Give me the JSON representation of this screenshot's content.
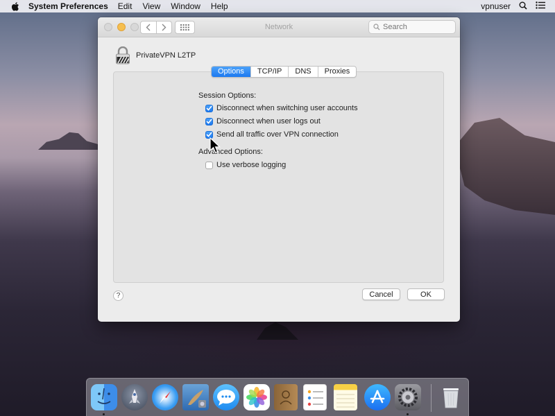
{
  "menubar": {
    "app_name": "System Preferences",
    "items": [
      "Edit",
      "View",
      "Window",
      "Help"
    ],
    "username": "vpnuser"
  },
  "window": {
    "title": "Network",
    "search_placeholder": "Search"
  },
  "vpn": {
    "name": "PrivateVPN L2TP"
  },
  "tabs": [
    {
      "label": "Options",
      "active": true
    },
    {
      "label": "TCP/IP",
      "active": false
    },
    {
      "label": "DNS",
      "active": false
    },
    {
      "label": "Proxies",
      "active": false
    }
  ],
  "session_options": {
    "label": "Session Options:",
    "items": [
      {
        "label": "Disconnect when switching user accounts",
        "checked": true
      },
      {
        "label": "Disconnect when user logs out",
        "checked": true
      },
      {
        "label": "Send all traffic over VPN connection",
        "checked": true
      }
    ]
  },
  "advanced_options": {
    "label": "Advanced Options:",
    "items": [
      {
        "label": "Use verbose logging",
        "checked": false
      }
    ]
  },
  "buttons": {
    "help": "?",
    "cancel": "Cancel",
    "ok": "OK"
  },
  "dock": {
    "apps": [
      "finder-icon",
      "launchpad-icon",
      "safari-icon",
      "mail-icon",
      "messages-icon",
      "photos-icon",
      "contacts-icon",
      "reminders-icon",
      "notes-icon",
      "app-store-icon",
      "system-preferences-icon",
      "trash-icon"
    ]
  },
  "colors": {
    "accent": "#1c79f0"
  }
}
